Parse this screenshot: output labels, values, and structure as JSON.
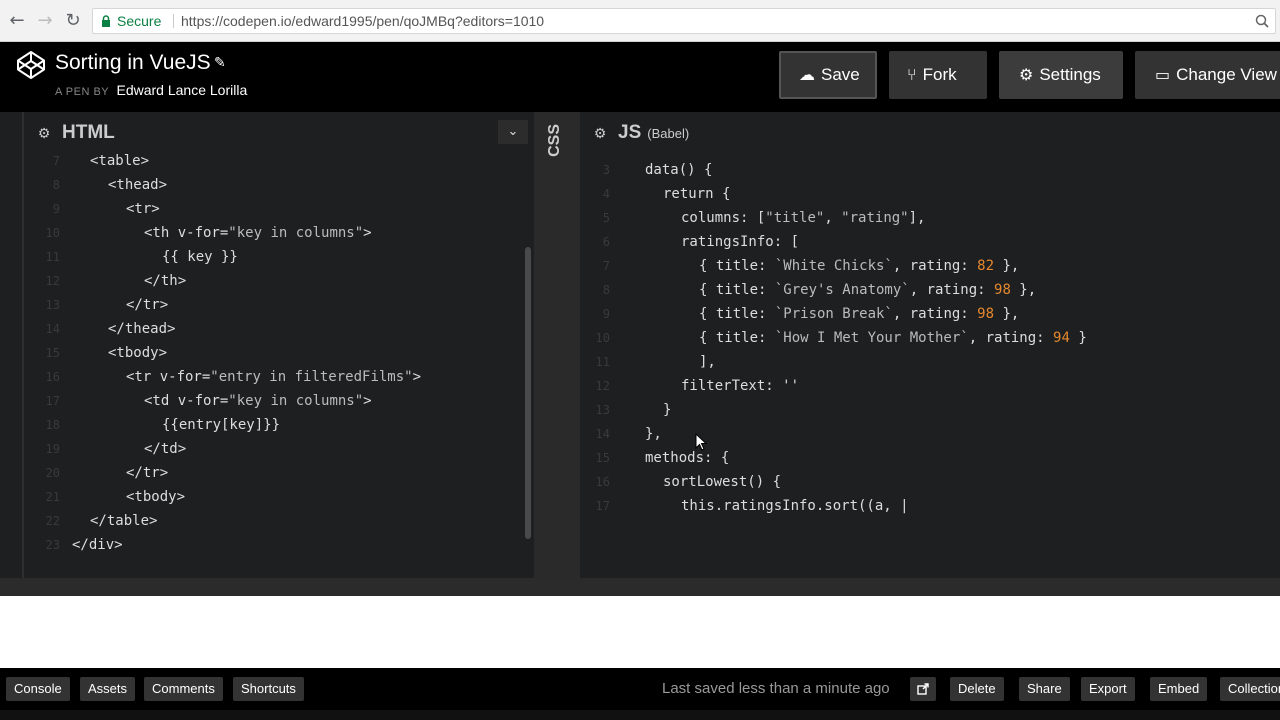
{
  "browser": {
    "secure_label": "Secure",
    "url": "https://codepen.io/edward1995/pen/qoJMBq?editors=1010",
    "back_icon": "arrow-left-icon",
    "forward_icon": "arrow-right-icon",
    "reload_icon": "reload-icon",
    "zoom_icon": "zoom-icon"
  },
  "header": {
    "title": "Sorting in VueJS",
    "byline_prefix": "A PEN BY",
    "author": "Edward Lance Lorilla",
    "buttons": {
      "save": "Save",
      "fork": "Fork",
      "settings": "Settings",
      "change_view": "Change View"
    }
  },
  "html_editor": {
    "title": "HTML",
    "lines": [
      {
        "n": "7",
        "indent": "  ",
        "code": "<table>"
      },
      {
        "n": "8",
        "indent": "    ",
        "code": "<thead>"
      },
      {
        "n": "9",
        "indent": "      ",
        "code": "<tr>"
      },
      {
        "n": "10",
        "indent": "        ",
        "code": "<th v-for=\"key in columns\">"
      },
      {
        "n": "11",
        "indent": "          ",
        "code": "{{ key }}"
      },
      {
        "n": "12",
        "indent": "        ",
        "code": "</th>"
      },
      {
        "n": "13",
        "indent": "      ",
        "code": "</tr>"
      },
      {
        "n": "14",
        "indent": "    ",
        "code": "</thead>"
      },
      {
        "n": "15",
        "indent": "    ",
        "code": "<tbody>"
      },
      {
        "n": "16",
        "indent": "      ",
        "code": "<tr v-for=\"entry in filteredFilms\">"
      },
      {
        "n": "17",
        "indent": "        ",
        "code": "<td v-for=\"key in columns\">"
      },
      {
        "n": "18",
        "indent": "          ",
        "code": "{{entry[key]}}"
      },
      {
        "n": "19",
        "indent": "        ",
        "code": "</td>"
      },
      {
        "n": "20",
        "indent": "      ",
        "code": "</tr>"
      },
      {
        "n": "21",
        "indent": "      ",
        "code": "<tbody>"
      },
      {
        "n": "22",
        "indent": "  ",
        "code": "</table>"
      },
      {
        "n": "23",
        "indent": "",
        "code": "</div>"
      }
    ]
  },
  "css_editor": {
    "title": "CSS"
  },
  "js_editor": {
    "title": "JS",
    "subtitle": "(Babel)",
    "lines": [
      {
        "n": "3",
        "indent": "  ",
        "code": "data() {"
      },
      {
        "n": "4",
        "indent": "    ",
        "code": "return {"
      },
      {
        "n": "5",
        "indent": "      ",
        "code": "columns: [\"title\", \"rating\"],"
      },
      {
        "n": "6",
        "indent": "      ",
        "code": "ratingsInfo: ["
      },
      {
        "n": "7",
        "indent": "        ",
        "code": "{ title: `White Chicks`, rating: 82 },"
      },
      {
        "n": "8",
        "indent": "        ",
        "code": "{ title: `Grey's Anatomy`, rating: 98 },"
      },
      {
        "n": "9",
        "indent": "        ",
        "code": "{ title: `Prison Break`, rating: 98 },"
      },
      {
        "n": "10",
        "indent": "        ",
        "code": "{ title: `How I Met Your Mother`, rating: 94 }"
      },
      {
        "n": "11",
        "indent": "        ",
        "code": "],"
      },
      {
        "n": "12",
        "indent": "      ",
        "code": "filterText: ''"
      },
      {
        "n": "13",
        "indent": "    ",
        "code": "}"
      },
      {
        "n": "14",
        "indent": "  ",
        "code": "},"
      },
      {
        "n": "15",
        "indent": "  ",
        "code": "methods: {"
      },
      {
        "n": "16",
        "indent": "    ",
        "code": "sortLowest() {"
      },
      {
        "n": "17",
        "indent": "      ",
        "code": "this.ratingsInfo.sort((a, |"
      }
    ]
  },
  "footer": {
    "console": "Console",
    "assets": "Assets",
    "comments": "Comments",
    "shortcuts": "Shortcuts",
    "saved_status": "Last saved less than a minute ago",
    "delete": "Delete",
    "share": "Share",
    "export": "Export",
    "embed": "Embed",
    "collections": "Collections"
  },
  "colors": {
    "header_bg": "#000000",
    "editor_bg": "#1d1f20",
    "number": "#e5882e",
    "secure": "#0b8043"
  }
}
